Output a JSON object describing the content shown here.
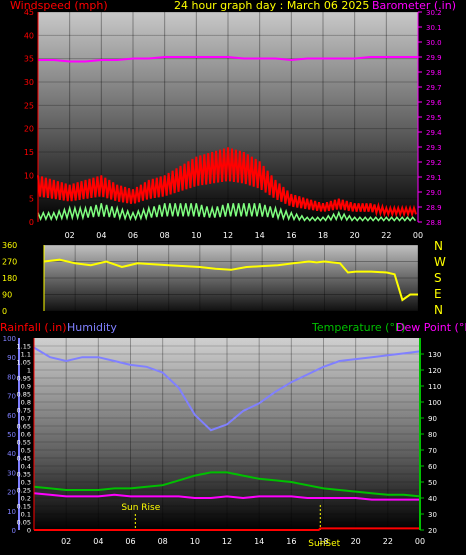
{
  "colors": {
    "wind": "#ff0000",
    "gust_shadow": "#000000",
    "avg": "#80ff80",
    "barometer": "#ff00ff",
    "direction": "#ffff00",
    "rainfall": "#ff0000",
    "humidity": "#8080ff",
    "temperature": "#00c000",
    "dewpoint": "#ff00ff",
    "title": "#ffff00",
    "axis_left": "#ff0000",
    "axis_right": "#ff00ff"
  },
  "top": {
    "title_left": "Windspeed (mph)",
    "title_center": "24 hour graph day : March 06 2025",
    "title_right": "Barometer (.in)"
  },
  "dir": {
    "letters": [
      "N",
      "W",
      "S",
      "E",
      "N"
    ]
  },
  "bottom": {
    "label_rain": "Rainfall (.in)",
    "label_hum": "Humidity",
    "label_temp": "Temperature (°F)",
    "label_dew": "Dew Point (°F)",
    "sunrise_label": "Sun Rise",
    "sunset_label": "SunSet"
  },
  "chart_data": [
    {
      "type": "line",
      "name": "wind-barometer",
      "x_ticks": [
        "02",
        "04",
        "06",
        "08",
        "10",
        "12",
        "14",
        "16",
        "18",
        "20",
        "22",
        "00"
      ],
      "xlim": [
        0,
        24
      ],
      "ylim_left": [
        0,
        45
      ],
      "y_ticks_left": [
        0,
        5,
        10,
        15,
        20,
        25,
        30,
        35,
        40,
        45
      ],
      "ylim_right": [
        28.8,
        30.2
      ],
      "y_ticks_right": [
        28.8,
        28.9,
        29.0,
        29.1,
        29.2,
        29.3,
        29.4,
        29.5,
        29.6,
        29.7,
        29.8,
        29.9,
        30.0,
        30.1,
        30.2
      ],
      "barometer": {
        "x": [
          0,
          1,
          2,
          3,
          4,
          5,
          6,
          7,
          8,
          9,
          10,
          11,
          12,
          13,
          14,
          15,
          16,
          17,
          18,
          19,
          20,
          21,
          22,
          23,
          24
        ],
        "y": [
          29.88,
          29.88,
          29.87,
          29.87,
          29.88,
          29.88,
          29.89,
          29.89,
          29.9,
          29.9,
          29.9,
          29.9,
          29.9,
          29.89,
          29.89,
          29.89,
          29.88,
          29.89,
          29.89,
          29.89,
          29.89,
          29.9,
          29.9,
          29.9,
          29.9
        ]
      },
      "wind_max": {
        "x": [
          0,
          1,
          2,
          3,
          4,
          5,
          6,
          7,
          8,
          9,
          10,
          11,
          12,
          13,
          14,
          15,
          16,
          17,
          18,
          19,
          20,
          21,
          22,
          23,
          24
        ],
        "y": [
          10,
          9,
          8,
          9,
          10,
          8,
          7,
          9,
          10,
          12,
          14,
          15,
          16,
          15,
          13,
          9,
          6,
          5,
          4,
          5,
          4,
          4,
          3,
          3,
          3
        ]
      },
      "wind_avg": {
        "x": [
          0,
          1,
          2,
          3,
          4,
          5,
          6,
          7,
          8,
          9,
          10,
          11,
          12,
          13,
          14,
          15,
          16,
          17,
          18,
          19,
          20,
          21,
          22,
          23,
          24
        ],
        "y": [
          2,
          2,
          3,
          3,
          4,
          3,
          2,
          3,
          4,
          4,
          4,
          3,
          4,
          4,
          4,
          3,
          2,
          1,
          1,
          2,
          1,
          1,
          1,
          1,
          1
        ]
      }
    },
    {
      "type": "line",
      "name": "wind-direction",
      "x_ticks": [
        "02",
        "04",
        "06",
        "08",
        "10",
        "12",
        "14",
        "16",
        "18",
        "20",
        "22",
        "00"
      ],
      "xlim": [
        0,
        24
      ],
      "ylim": [
        0,
        360
      ],
      "y_ticks": [
        0,
        90,
        180,
        270,
        360
      ],
      "direction": {
        "x": [
          0,
          1,
          2,
          3,
          4,
          5,
          6,
          7,
          8,
          9,
          10,
          11,
          12,
          13,
          14,
          15,
          16,
          17,
          17.5,
          18,
          19,
          19.5,
          20,
          21,
          22,
          22.5,
          23,
          23.5,
          24
        ],
        "y": [
          270,
          280,
          260,
          250,
          270,
          240,
          260,
          255,
          250,
          245,
          240,
          230,
          225,
          240,
          245,
          250,
          260,
          270,
          265,
          270,
          260,
          210,
          215,
          215,
          210,
          200,
          60,
          90,
          90
        ]
      }
    },
    {
      "type": "line",
      "name": "humidity-temperature",
      "x_ticks": [
        "02",
        "04",
        "06",
        "08",
        "10",
        "12",
        "14",
        "16",
        "18",
        "20",
        "22",
        "00"
      ],
      "xlim": [
        0,
        24
      ],
      "ylim_rain": [
        0,
        1.2
      ],
      "y_ticks_rain": [
        0,
        0.05,
        0.1,
        0.15,
        0.2,
        0.25,
        0.3,
        0.35,
        0.4,
        0.45,
        0.5,
        0.55,
        0.6,
        0.65,
        0.7,
        0.75,
        0.8,
        0.85,
        0.9,
        0.95,
        1,
        1.05,
        1.1,
        1.15
      ],
      "ylim_humidity": [
        0,
        100
      ],
      "y_ticks_humidity": [
        0,
        10,
        20,
        30,
        40,
        50,
        60,
        70,
        80,
        90,
        100
      ],
      "ylim_temp": [
        20,
        140
      ],
      "y_ticks_temp": [
        20,
        30,
        40,
        50,
        60,
        70,
        80,
        90,
        100,
        110,
        120,
        130
      ],
      "humidity": {
        "x": [
          0,
          1,
          2,
          3,
          4,
          5,
          6,
          7,
          8,
          9,
          10,
          11,
          12,
          13,
          14,
          15,
          16,
          17,
          18,
          19,
          20,
          21,
          22,
          23,
          24
        ],
        "y": [
          95,
          90,
          88,
          90,
          90,
          88,
          86,
          85,
          82,
          74,
          60,
          52,
          55,
          62,
          66,
          72,
          77,
          81,
          85,
          88,
          89,
          90,
          91,
          92,
          93
        ]
      },
      "temperature": {
        "x": [
          0,
          1,
          2,
          3,
          4,
          5,
          6,
          7,
          8,
          9,
          10,
          11,
          12,
          13,
          14,
          15,
          16,
          17,
          18,
          19,
          20,
          21,
          22,
          23,
          24
        ],
        "y": [
          47,
          46,
          45,
          45,
          45,
          46,
          46,
          47,
          48,
          51,
          54,
          56,
          56,
          54,
          52,
          51,
          50,
          48,
          46,
          45,
          44,
          43,
          42,
          42,
          41
        ]
      },
      "dewpoint": {
        "x": [
          0,
          1,
          2,
          3,
          4,
          5,
          6,
          7,
          8,
          9,
          10,
          11,
          12,
          13,
          14,
          15,
          16,
          17,
          18,
          19,
          20,
          21,
          22,
          23,
          24
        ],
        "y": [
          43,
          42,
          41,
          41,
          41,
          42,
          41,
          41,
          41,
          41,
          40,
          40,
          41,
          40,
          41,
          41,
          41,
          40,
          40,
          40,
          40,
          39,
          39,
          39,
          39
        ]
      },
      "rainfall": {
        "x": [
          0,
          17.7,
          17.8,
          24
        ],
        "y": [
          0.0,
          0.0,
          0.01,
          0.01
        ]
      },
      "sunrise_hour": 6.3,
      "sunset_hour": 17.8
    }
  ]
}
